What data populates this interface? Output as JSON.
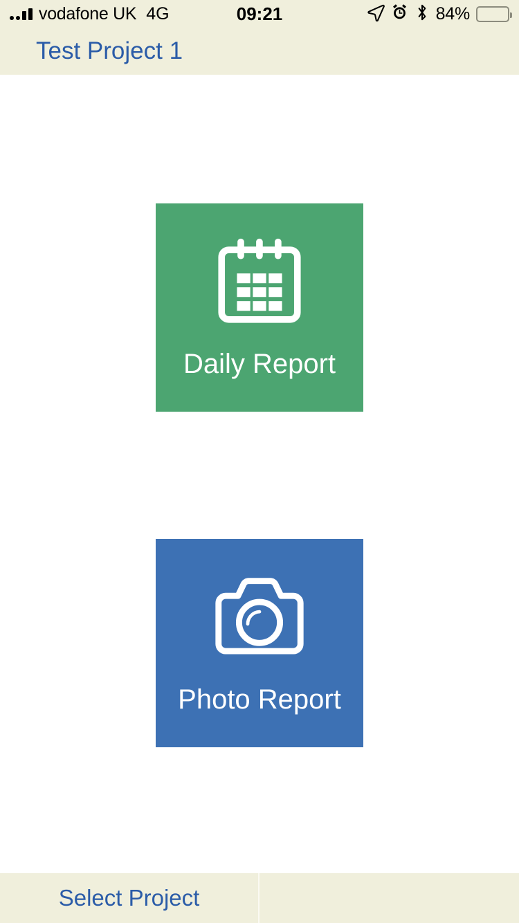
{
  "status_bar": {
    "signal_icon": "signal-bars-icon",
    "carrier": "vodafone UK",
    "network": "4G",
    "time": "09:21",
    "location_icon": "location-arrow-icon",
    "alarm_icon": "alarm-clock-icon",
    "bluetooth_icon": "bluetooth-icon",
    "battery_percent": "84%",
    "battery_icon": "battery-icon",
    "background": "#F0EFDC"
  },
  "nav_bar": {
    "title": "Test Project 1",
    "title_color": "#2B5CA8",
    "background": "#F0EFDC"
  },
  "main": {
    "background": "#FFFFFF",
    "tiles": [
      {
        "label": "Daily Report",
        "icon": "calendar-icon",
        "color": "#4CA571",
        "text_color": "#FFFFFF"
      },
      {
        "label": "Photo Report",
        "icon": "camera-icon",
        "color": "#3D71B4",
        "text_color": "#FFFFFF"
      }
    ]
  },
  "toolbar": {
    "background": "#F0EFDC",
    "select_project_label": "Select Project",
    "label_color": "#2B5CA8"
  }
}
